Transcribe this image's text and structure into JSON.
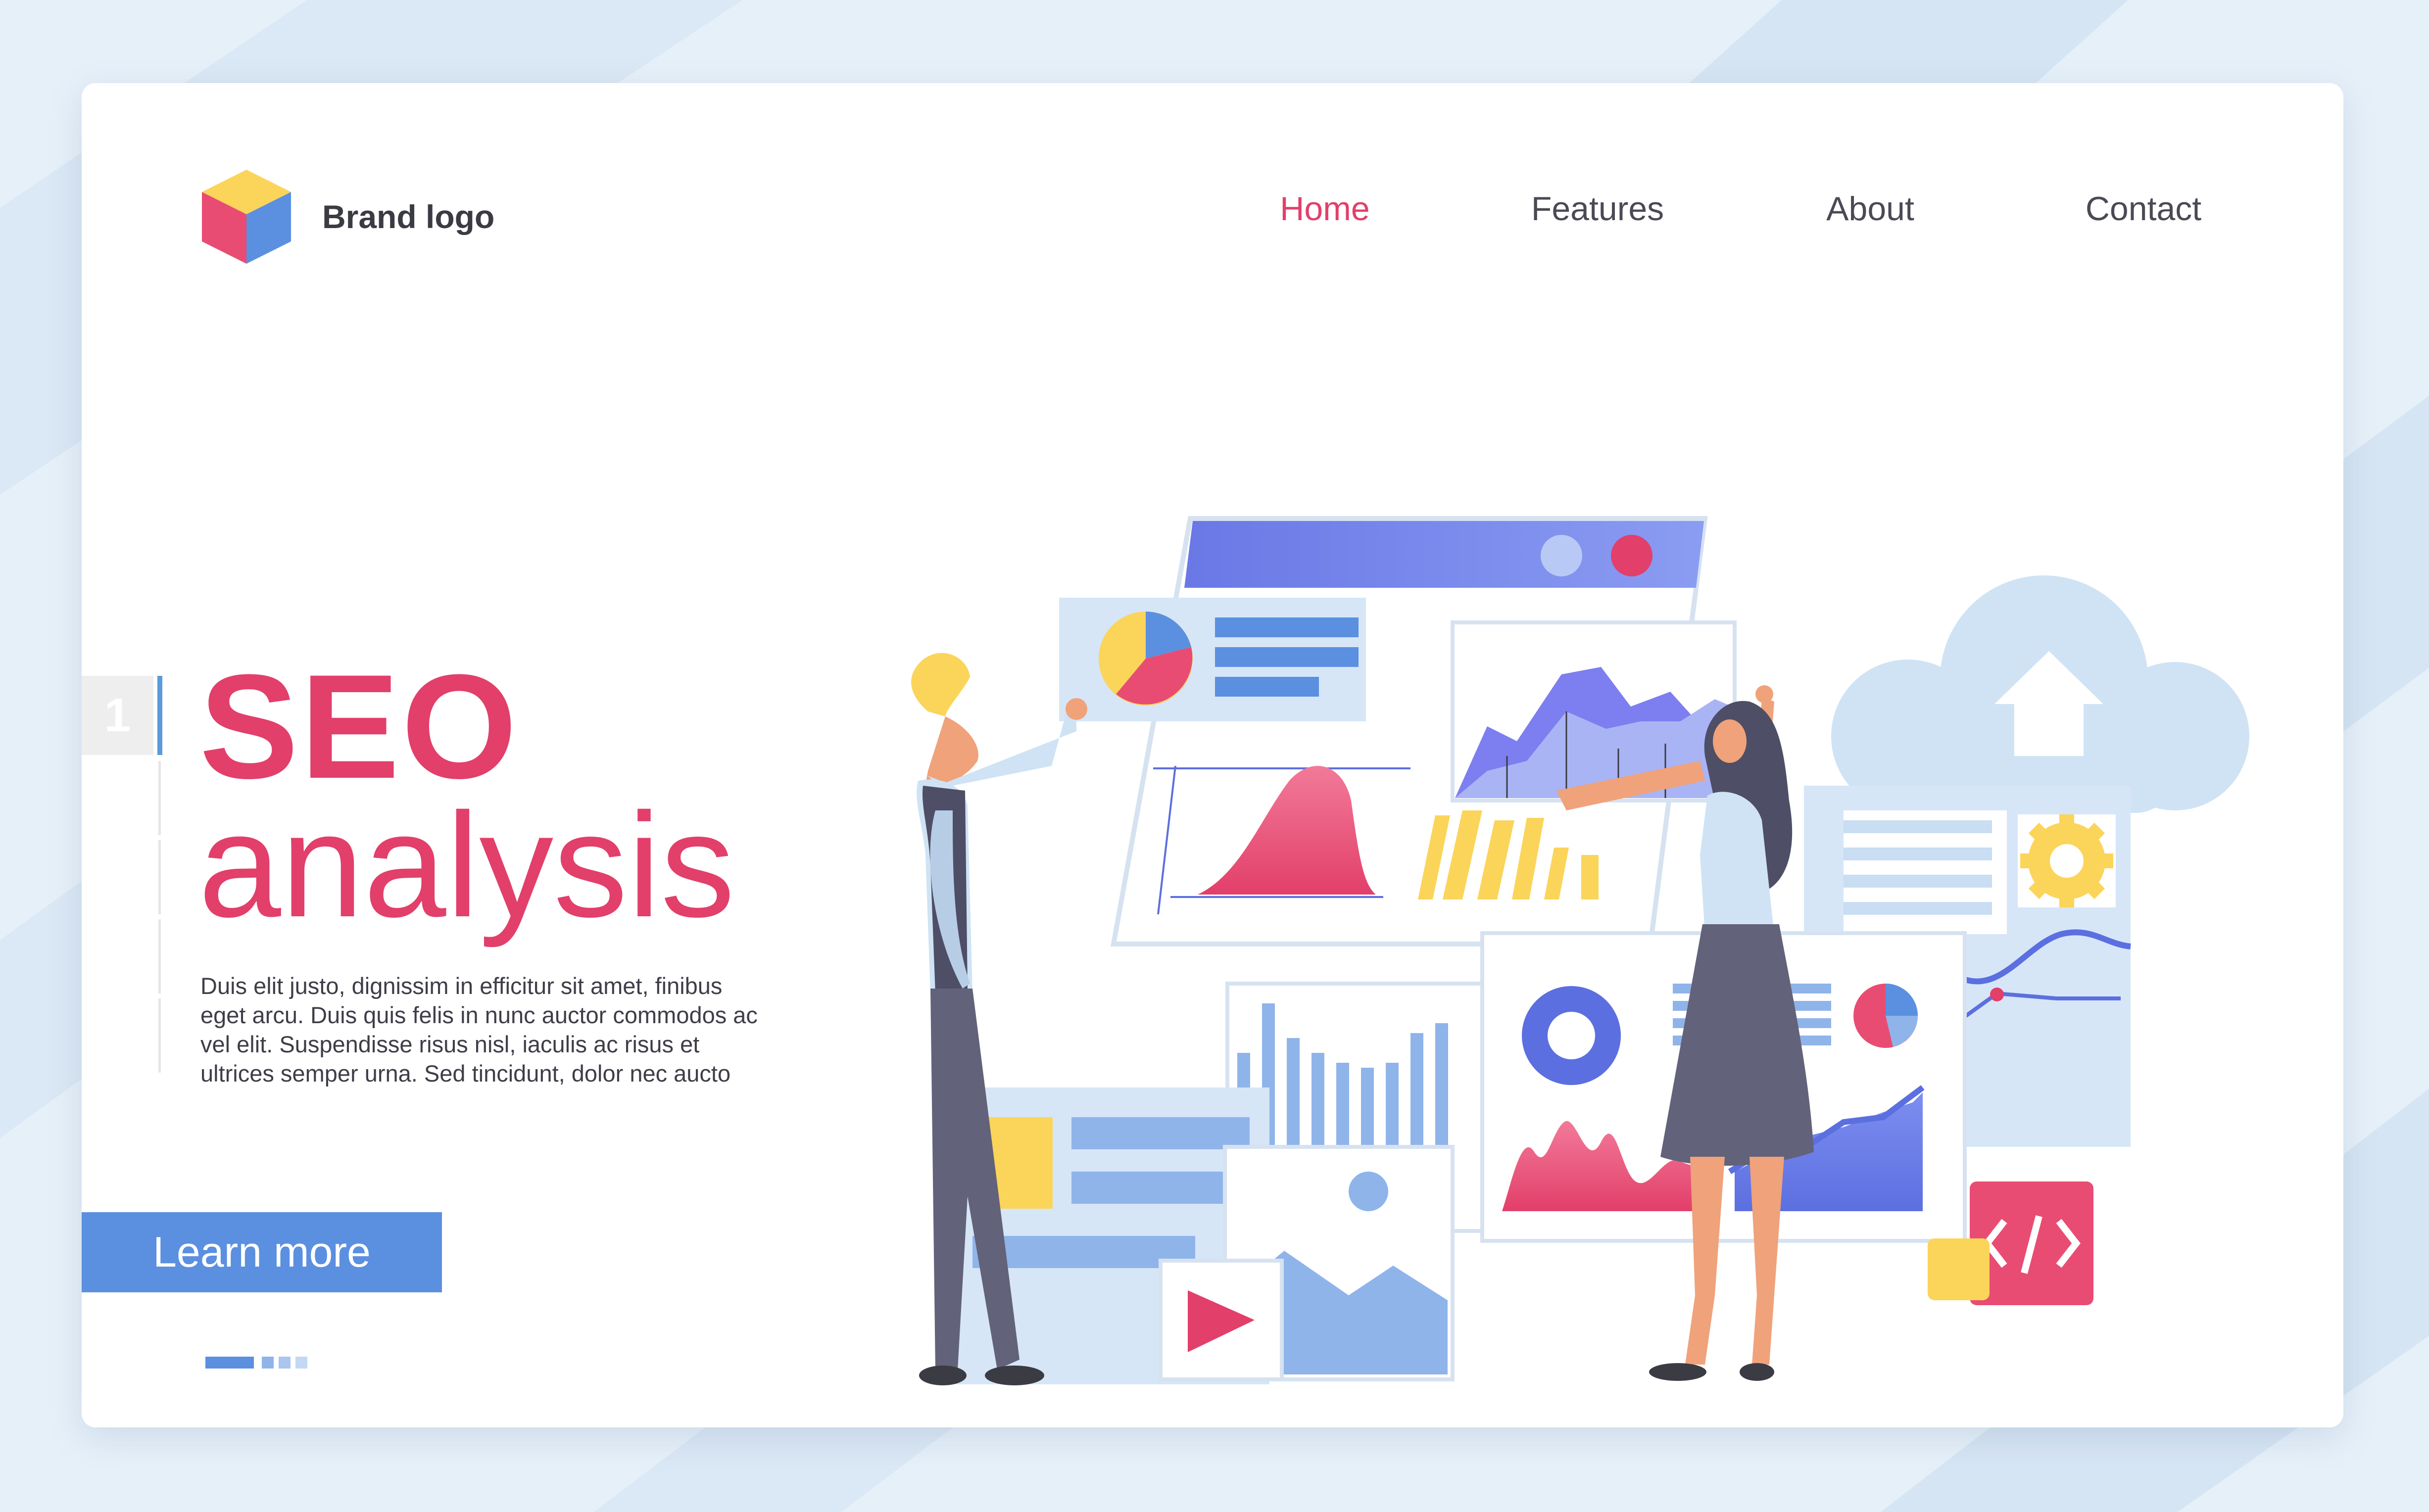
{
  "brand": {
    "name": "Brand logo",
    "logo_icon": "cube-logo-icon"
  },
  "nav": {
    "items": [
      {
        "label": "Home",
        "active": true
      },
      {
        "label": "Features",
        "active": false
      },
      {
        "label": "About",
        "active": false
      },
      {
        "label": "Contact",
        "active": false
      }
    ]
  },
  "hero": {
    "slide_number": "1",
    "title_line1": "SEO",
    "title_line2": "analysis",
    "body": "Duis elit justo, dignissim in efficitur sit amet, finibus eget arcu. Duis quis felis in nunc auctor commodos ac vel elit. Suspendisse risus nisl, iaculis ac risus et ultrices semper urna. Sed tincidunt, dolor nec aucto",
    "cta_label": "Learn more"
  },
  "pager": {
    "count": 4,
    "active_index": 0
  },
  "colors": {
    "accent": "#e23f6a",
    "button": "#5b8fe0",
    "text_dark": "#3b3b44",
    "background": "#e6f0f9"
  },
  "illustration": {
    "icons": [
      "browser-window-icon",
      "pie-chart-icon",
      "bell-curve-chart-icon",
      "area-chart-icon",
      "cloud-home-icon",
      "gear-icon",
      "code-tag-icon",
      "play-video-icon",
      "image-icon",
      "donut-chart-icon",
      "bar-chart-icon"
    ]
  }
}
